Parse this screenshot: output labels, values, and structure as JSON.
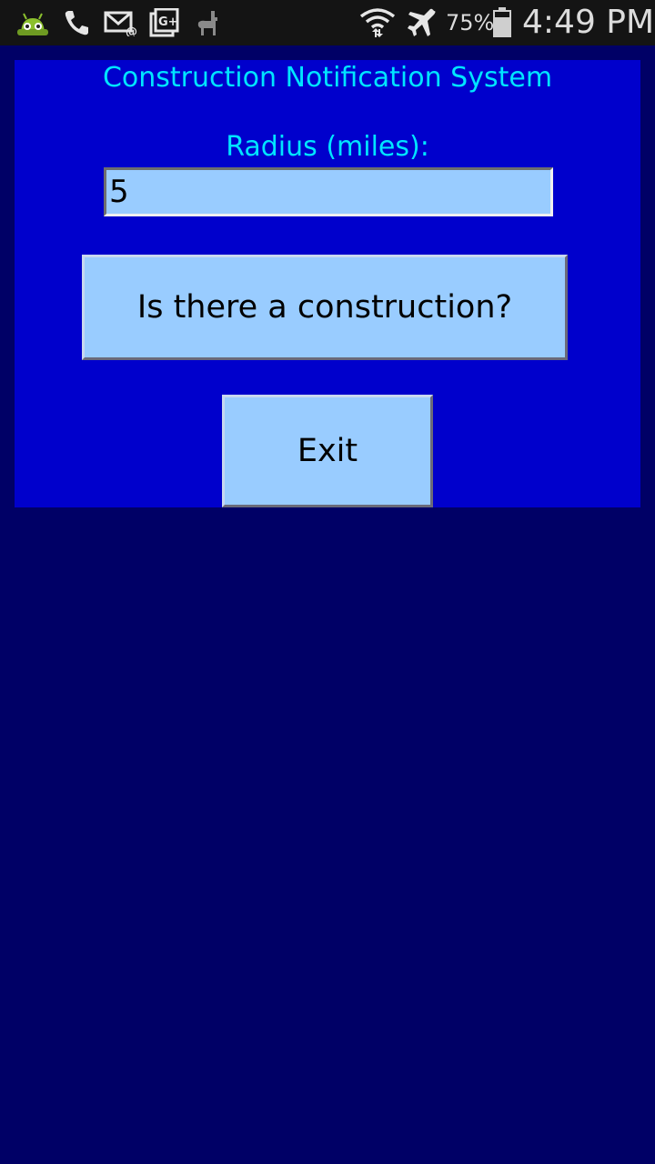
{
  "status_bar": {
    "battery_percent": "75%",
    "time": "4:49 PM",
    "icons": [
      "android-robot-icon",
      "phone-icon",
      "email-icon",
      "google-plus-icon",
      "llama-icon",
      "wifi-icon",
      "airplane-mode-icon",
      "battery-icon"
    ]
  },
  "app": {
    "title": "Construction Notification System",
    "radius_label": "Radius (miles):",
    "radius_value": "5",
    "check_button_label": "Is there a construction?",
    "exit_button_label": "Exit"
  },
  "colors": {
    "background": "#000066",
    "panel": "#0000cc",
    "text_accent": "#00e5ff",
    "control_fill": "#99ccff",
    "status_bar": "#141414"
  }
}
